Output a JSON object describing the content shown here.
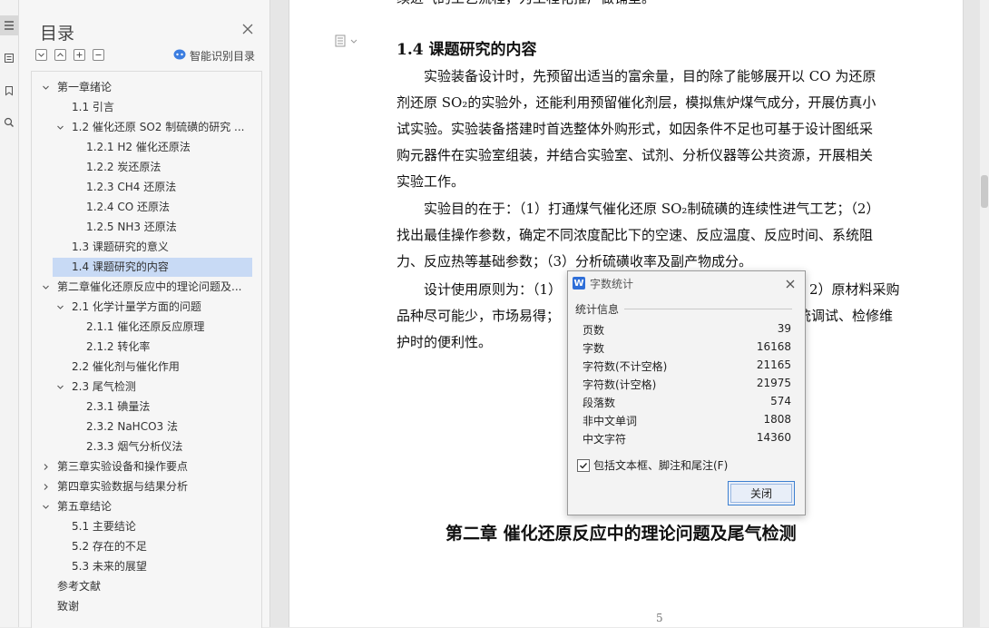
{
  "toc": {
    "title": "目录",
    "smart_label": "智能识别目录",
    "items": [
      {
        "label": "第一章绪论",
        "level": 0,
        "arrow": "down"
      },
      {
        "label": "1.1  引言",
        "level": 1,
        "arrow": ""
      },
      {
        "label": "1.2  催化还原 SO2 制硫磺的研究 ...",
        "level": 1,
        "arrow": "down"
      },
      {
        "label": "1.2.1 H2 催化还原法",
        "level": 2,
        "arrow": ""
      },
      {
        "label": "1.2.2  炭还原法",
        "level": 2,
        "arrow": ""
      },
      {
        "label": "1.2.3 CH4 还原法",
        "level": 2,
        "arrow": ""
      },
      {
        "label": "1.2.4 CO 还原法",
        "level": 2,
        "arrow": ""
      },
      {
        "label": "1.2.5 NH3 还原法",
        "level": 2,
        "arrow": ""
      },
      {
        "label": "1.3  课题研究的意义",
        "level": 1,
        "arrow": ""
      },
      {
        "label": "1.4  课题研究的内容",
        "level": 1,
        "arrow": "",
        "selected": true
      },
      {
        "label": "第二章催化还原反应中的理论问题及...",
        "level": 0,
        "arrow": "down"
      },
      {
        "label": "2.1  化学计量学方面的问题",
        "level": 1,
        "arrow": "down"
      },
      {
        "label": "2.1.1  催化还原反应原理",
        "level": 2,
        "arrow": ""
      },
      {
        "label": "2.1.2  转化率",
        "level": 2,
        "arrow": ""
      },
      {
        "label": "2.2 催化剂与催化作用",
        "level": 1,
        "arrow": ""
      },
      {
        "label": "2.3  尾气检测",
        "level": 1,
        "arrow": "down"
      },
      {
        "label": "2.3.1  碘量法",
        "level": 2,
        "arrow": ""
      },
      {
        "label": "2.3.2 NaHCO3 法",
        "level": 2,
        "arrow": ""
      },
      {
        "label": "2.3.3  烟气分析仪法",
        "level": 2,
        "arrow": ""
      },
      {
        "label": "第三章实验设备和操作要点",
        "level": 0,
        "arrow": "right"
      },
      {
        "label": "第四章实验数据与结果分析",
        "level": 0,
        "arrow": "right"
      },
      {
        "label": "第五章结论",
        "level": 0,
        "arrow": "down"
      },
      {
        "label": "5.1  主要结论",
        "level": 1,
        "arrow": ""
      },
      {
        "label": "5.2  存在的不足",
        "level": 1,
        "arrow": ""
      },
      {
        "label": "5.3  未来的展望",
        "level": 1,
        "arrow": ""
      },
      {
        "label": "参考文献",
        "level": 0,
        "arrow": ""
      },
      {
        "label": "致谢",
        "level": 0,
        "arrow": ""
      }
    ]
  },
  "document": {
    "top_fragment": "续进气的工艺流程，为工程化推广做铺垫。",
    "section_heading": "1.4  课题研究的内容",
    "lines": [
      "实验装备设计时，先预留出适当的富余量，目的除了能够展开以 CO 为还原",
      "剂还原 SO₂的实验外，还能利用预留催化剂层，模拟焦炉煤气成分，开展仿真小",
      "试实验。实验装备搭建时首选整体外购形式，如因条件不足也可基于设计图纸采",
      "购元器件在实验室组装，并结合实验室、试剂、分析仪器等公共资源，开展相关",
      "实验工作。",
      "实验目的在于：（1）打通煤气催化还原 SO₂制硫磺的连续性进气工艺；（2）",
      "找出最佳操作参数，确定不同浓度配比下的空速、反应温度、反应时间、系统阻",
      "力、反应热等基础参数；（3）分析硫磺收率及副产物成分。",
      "设计使用原则为：（1）",
      "品种尽可能少，市场易得；",
      "护时的便利性。"
    ],
    "lines_right": [
      "2）原材料采购",
      "统调试、检修维"
    ],
    "chapter_heading": "第二章   催化还原反应中的理论问题及尾气检测",
    "page_number": "5"
  },
  "dialog": {
    "title": "字数统计",
    "group_label": "统计信息",
    "stats": [
      {
        "label": "页数",
        "value": "39"
      },
      {
        "label": "字数",
        "value": "16168"
      },
      {
        "label": "字符数(不计空格)",
        "value": "21165"
      },
      {
        "label": "字符数(计空格)",
        "value": "21975"
      },
      {
        "label": "段落数",
        "value": "574"
      },
      {
        "label": "非中文单词",
        "value": "1808"
      },
      {
        "label": "中文字符",
        "value": "14360"
      }
    ],
    "checkbox_label": "包括文本框、脚注和尾注(F)",
    "checkbox_checked": true,
    "close_button": "关闭"
  }
}
